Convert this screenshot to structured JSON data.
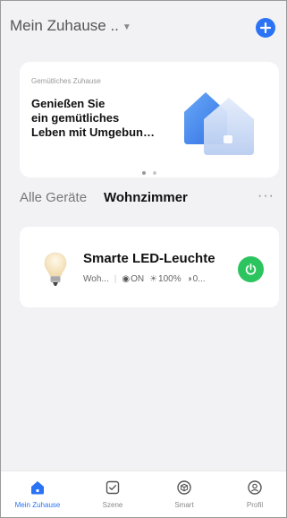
{
  "header": {
    "home_name": "Mein Zuhause ..",
    "add_icon": "plus-circle-icon",
    "accent": "#2a73f5"
  },
  "banner": {
    "small_text": "Gemütliches Zuhause",
    "headline_line1": "Genießen Sie",
    "headline_line2": "ein gemütliches",
    "headline_line3": "Leben mit Umgebun…",
    "active_page": 1,
    "page_count": 2
  },
  "tabs": {
    "all_label": "Alle Geräte",
    "room_label": "Wohnzimmer",
    "more_label": "···"
  },
  "device": {
    "name": "Smarte LED-Leuchte",
    "room": "Woh...",
    "state": "ON",
    "brightness": "100%",
    "extra": "0...",
    "power_color": "#2cc45e",
    "icon": "light-bulb-icon"
  },
  "nav": {
    "items": [
      {
        "label": "Mein Zuhause",
        "icon": "home-icon",
        "active": true
      },
      {
        "label": "Szene",
        "icon": "scene-checkbox-icon",
        "active": false
      },
      {
        "label": "Smart",
        "icon": "smart-cube-icon",
        "active": false
      },
      {
        "label": "Profil",
        "icon": "profile-icon",
        "active": false
      }
    ]
  }
}
